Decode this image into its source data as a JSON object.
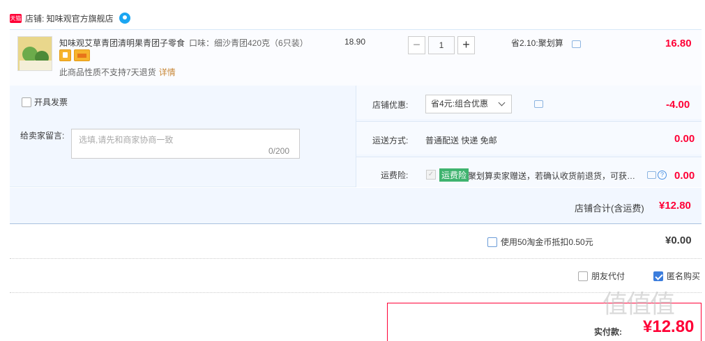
{
  "shop": {
    "badge": "天猫",
    "label": "店铺: 知味观官方旗舰店"
  },
  "item": {
    "title": "知味观艾草青团清明果青团子零食",
    "spec": "口味：细沙青团420克（6只装）",
    "no_return": "此商品性质不支持7天退货",
    "detail": "详情",
    "unit_price": "18.90",
    "qty_minus": "−",
    "quantity": "1",
    "qty_plus": "+",
    "saving": "省2.10:聚划算",
    "total": "16.80"
  },
  "options": {
    "invoice": "开具发票",
    "memo_label": "给卖家留言:",
    "memo_placeholder": "选填,请先和商家协商一致",
    "memo_count": "0/200",
    "shop_discount_label": "店铺优惠:",
    "shop_discount_value": "省4元:组合优惠",
    "shop_discount_amount": "-4.00",
    "shipping_label": "运送方式:",
    "shipping_value": "普通配送 快递 免邮",
    "shipping_amount": "0.00",
    "insurance_label": "运费险:",
    "insurance_check": "✓",
    "insurance_badge": "运费险",
    "insurance_text": "聚划算卖家赠送，若确认收货前退货，可获保险赔付",
    "insurance_help": "?",
    "insurance_amount": "0.00"
  },
  "subtotal": {
    "label": "店铺合计(含运费)",
    "amount": "¥12.80"
  },
  "coins": {
    "label": "使用50淘金币抵扣0.50元",
    "amount": "¥0.00"
  },
  "checkout": {
    "friend_pay": "朋友代付",
    "anonymous": "匿名购买",
    "pay_label": "实付款:",
    "pay_amount": "¥12.80",
    "watermark": "值值值"
  },
  "colors": {
    "accent": "#ff0036",
    "panel": "#f2f7ff",
    "insurance": "#3fb36f"
  },
  "icons": [
    "tmall-badge",
    "wangwang-icon",
    "message-icon",
    "help-icon",
    "checkbox"
  ]
}
